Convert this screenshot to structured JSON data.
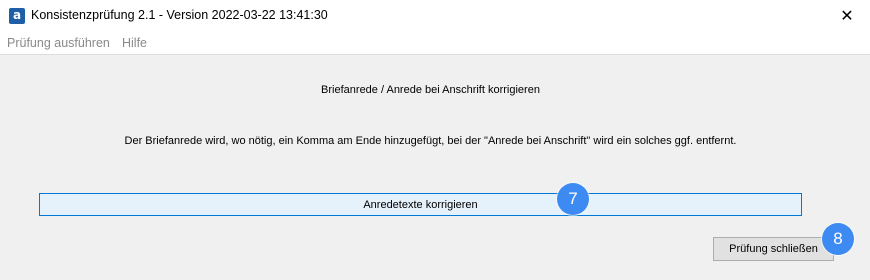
{
  "window": {
    "title": "Konsistenzprüfung 2.1 - Version 2022-03-22 13:41:30",
    "app_icon_glyph": "a",
    "close_glyph": "✕"
  },
  "menu": {
    "items": [
      "Prüfung ausführen",
      "Hilfe"
    ]
  },
  "main": {
    "heading": "Briefanrede / Anrede bei Anschrift korrigieren",
    "description": "Der Briefanrede wird, wo nötig, ein Komma am Ende hinzugefügt, bei der \"Anrede bei Anschrift\" wird ein solches ggf. entfernt.",
    "correct_button": "Anredetexte korrigieren",
    "close_button": "Prüfung schließen"
  },
  "badges": {
    "step7": "7",
    "step8": "8"
  },
  "colors": {
    "badge": "#3d8bf2",
    "focus_border": "#0078d7",
    "app_icon": "#1f5fa8"
  }
}
